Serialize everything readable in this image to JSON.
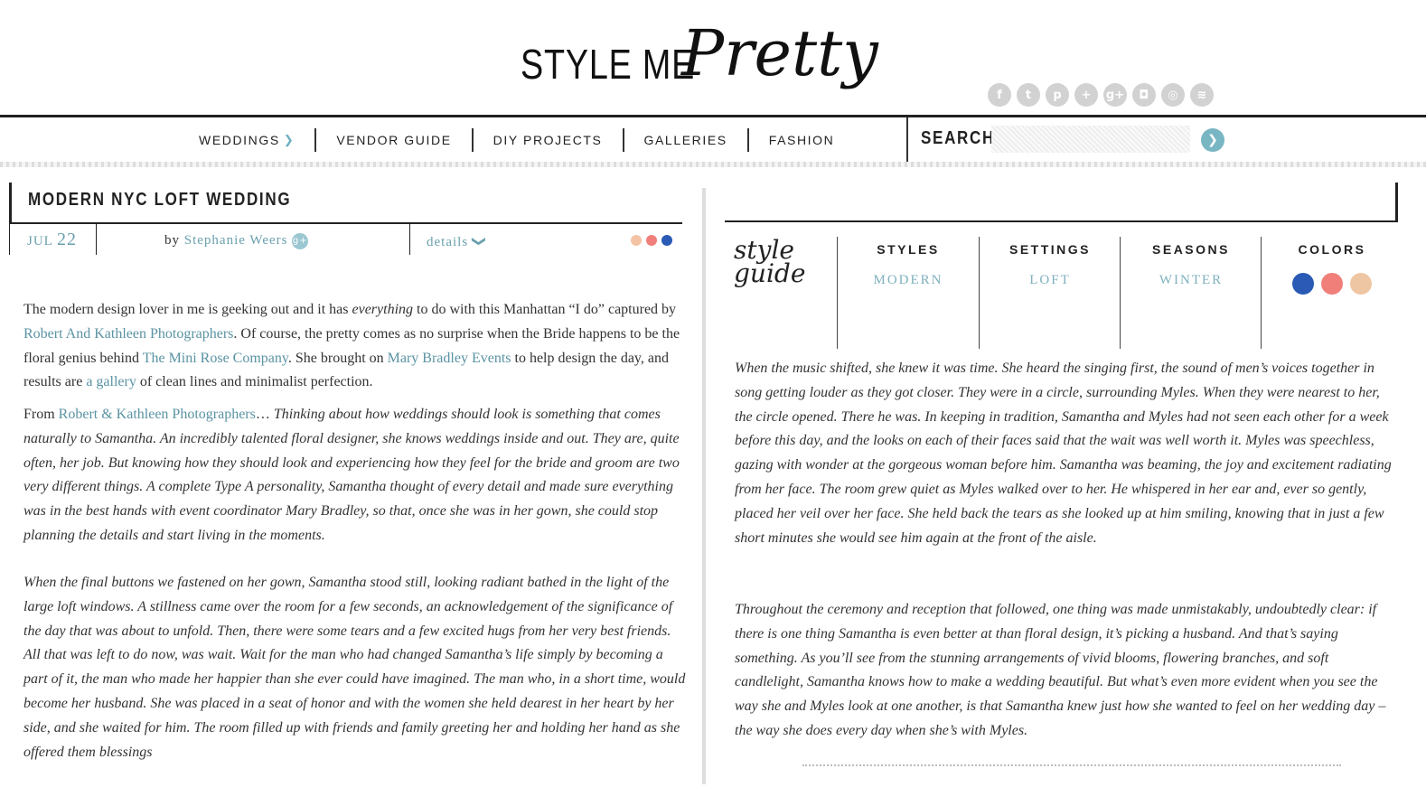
{
  "site": {
    "logo_text_left": "STYLE ME",
    "logo_text_script": "Pretty",
    "social_icons": [
      "facebook-icon",
      "twitter-icon",
      "pinterest-icon",
      "plus-icon",
      "google-plus-icon",
      "instagram-icon",
      "camera-icon",
      "rss-icon"
    ],
    "social_glyphs": [
      "f",
      "t",
      "p",
      "+",
      "g+",
      "◘",
      "◎",
      "≋"
    ]
  },
  "nav": {
    "items": [
      {
        "label": "WEDDINGS",
        "has_chevron": true
      },
      {
        "label": "VENDOR GUIDE"
      },
      {
        "label": "DIY PROJECTS"
      },
      {
        "label": "GALLERIES"
      },
      {
        "label": "FASHION"
      }
    ],
    "search_label": "SEARCH",
    "search_placeholder": ""
  },
  "post": {
    "title": "MODERN NYC LOFT WEDDING",
    "date_month": "JUL",
    "date_day": "22",
    "by_label": "by",
    "author": "Stephanie Weers",
    "details_label": "details",
    "color_dots": [
      "#f3c3a4",
      "#f07f7a",
      "#2a5ab5"
    ],
    "intro": {
      "p1": "The modern design lover in me is geeking out and it has ",
      "p1_em": "everything",
      "p2": " to do with this Manhattan “I do” captured by ",
      "link1": "Robert And Kathleen Photographers",
      "p3": ". Of course, the pretty comes as no surprise when the Bride happens to be the floral genius behind ",
      "link2": "The Mini Rose Company",
      "p4": ". She brought on ",
      "link3": "Mary Bradley Events",
      "p5": " to help design the day, and results are ",
      "link4": "a gallery",
      "p6": " of clean lines and minimalist perfection."
    },
    "from": {
      "label": "From ",
      "link": "Robert & Kathleen Photographers",
      "ellipsis": "… ",
      "text": "Thinking about how weddings should look is something that comes naturally to Samantha. An incredibly talented floral designer, she knows weddings inside and out. They are, quite often, her job. But knowing how they should look and experiencing how they feel for the bride and groom are two very different things. A complete Type A personality, Samantha thought of every detail and made sure everything was in the best hands with event coordinator Mary Bradley, so that, once she was in her gown, she could stop planning the details and start living in the moments."
    },
    "para3": "When the final buttons we fastened on her gown, Samantha stood still, looking radiant bathed in the light of the large loft windows. A stillness came over the room for a few seconds, an acknowledgement of the significance of the day that was about to unfold. Then, there were some tears and a few excited hugs from her very best friends. All that was left to do now, was wait. Wait for the man who had changed Samantha’s life simply by becoming a part of it, the man who made her happier than she ever could have imagined. The man who, in a short time, would become her husband. She was placed in a seat of honor and with the women she held dearest in her heart by her side, and she waited for him. The room filled up with friends and family greeting her and holding her hand as she offered them blessings"
  },
  "style_guide": {
    "title_line1": "style",
    "title_line2": "guide",
    "columns": [
      {
        "heading": "STYLES",
        "value": "MODERN"
      },
      {
        "heading": "SETTINGS",
        "value": "LOFT"
      },
      {
        "heading": "SEASONS",
        "value": "WINTER"
      },
      {
        "heading": "COLORS",
        "value": ""
      }
    ],
    "colors": [
      "#2a5ab5",
      "#f07f7a",
      "#efc6a3"
    ]
  },
  "right_text": {
    "para1": "When the music shifted, she knew it was time. She heard the singing first, the sound of men’s voices together in song getting louder as they got closer. They were in a circle, surrounding Myles. When they were nearest to her, the circle opened. There he was. In keeping in tradition, Samantha and Myles had not seen each other for a week before this day, and the looks on each of their faces said that the wait was well worth it. Myles was speechless, gazing with wonder at the gorgeous woman before him. Samantha was beaming, the joy and excitement radiating from her face. The room grew quiet as Myles walked over to her. He whispered in her ear and, ever so gently, placed her veil over her face. She held back the tears as she looked up at him smiling, knowing that in just a few short minutes she would see him again at the front of the aisle.",
    "para2": "Throughout the ceremony and reception that followed, one thing was made unmistakably, undoubtedly clear: if there is one thing Samantha is even better at than floral design, it’s picking a husband. And that’s saying something. As you’ll see from the stunning arrangements of vivid blooms, flowering branches, and soft candlelight, Samantha knows how to make a wedding beautiful. But what’s even more evident when you see the way she and Myles look at one another, is that Samantha knew just how she wanted to feel on her wedding day – the way she does every day when she’s with Myles."
  }
}
